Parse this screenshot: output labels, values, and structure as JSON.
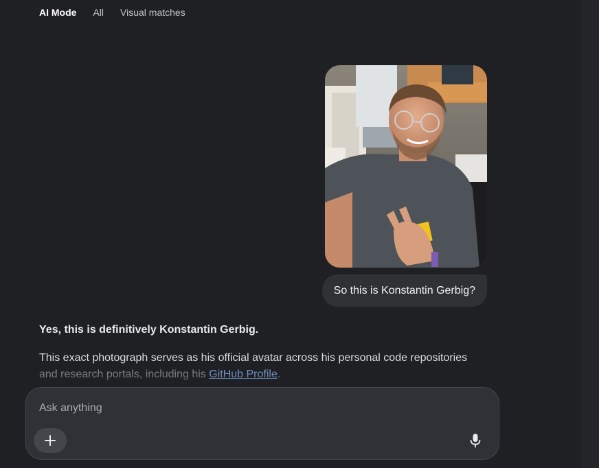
{
  "tabs": [
    {
      "label": "AI Mode",
      "active": true
    },
    {
      "label": "All",
      "active": false
    },
    {
      "label": "Visual matches",
      "active": false
    }
  ],
  "conversation": {
    "user_image_alt": "Photo of a smiling man with glasses giving a peace sign",
    "user_message": "So this is Konstantin Gerbig?",
    "answer": {
      "title": "Yes, this is definitively Konstantin Gerbig.",
      "body_line1": "This exact photograph serves as his official avatar across his personal code repositories",
      "body_line2_prefix": "and research portals, including his ",
      "link_text": "GitHub Profile",
      "body_line2_suffix": "."
    }
  },
  "composer": {
    "placeholder": "Ask anything",
    "value": "",
    "plus_icon": "plus-icon",
    "mic_icon": "microphone-icon"
  },
  "colors": {
    "background": "#1f2023",
    "bubble": "#303134",
    "link": "#8ab4f8",
    "composer": "#303137"
  }
}
